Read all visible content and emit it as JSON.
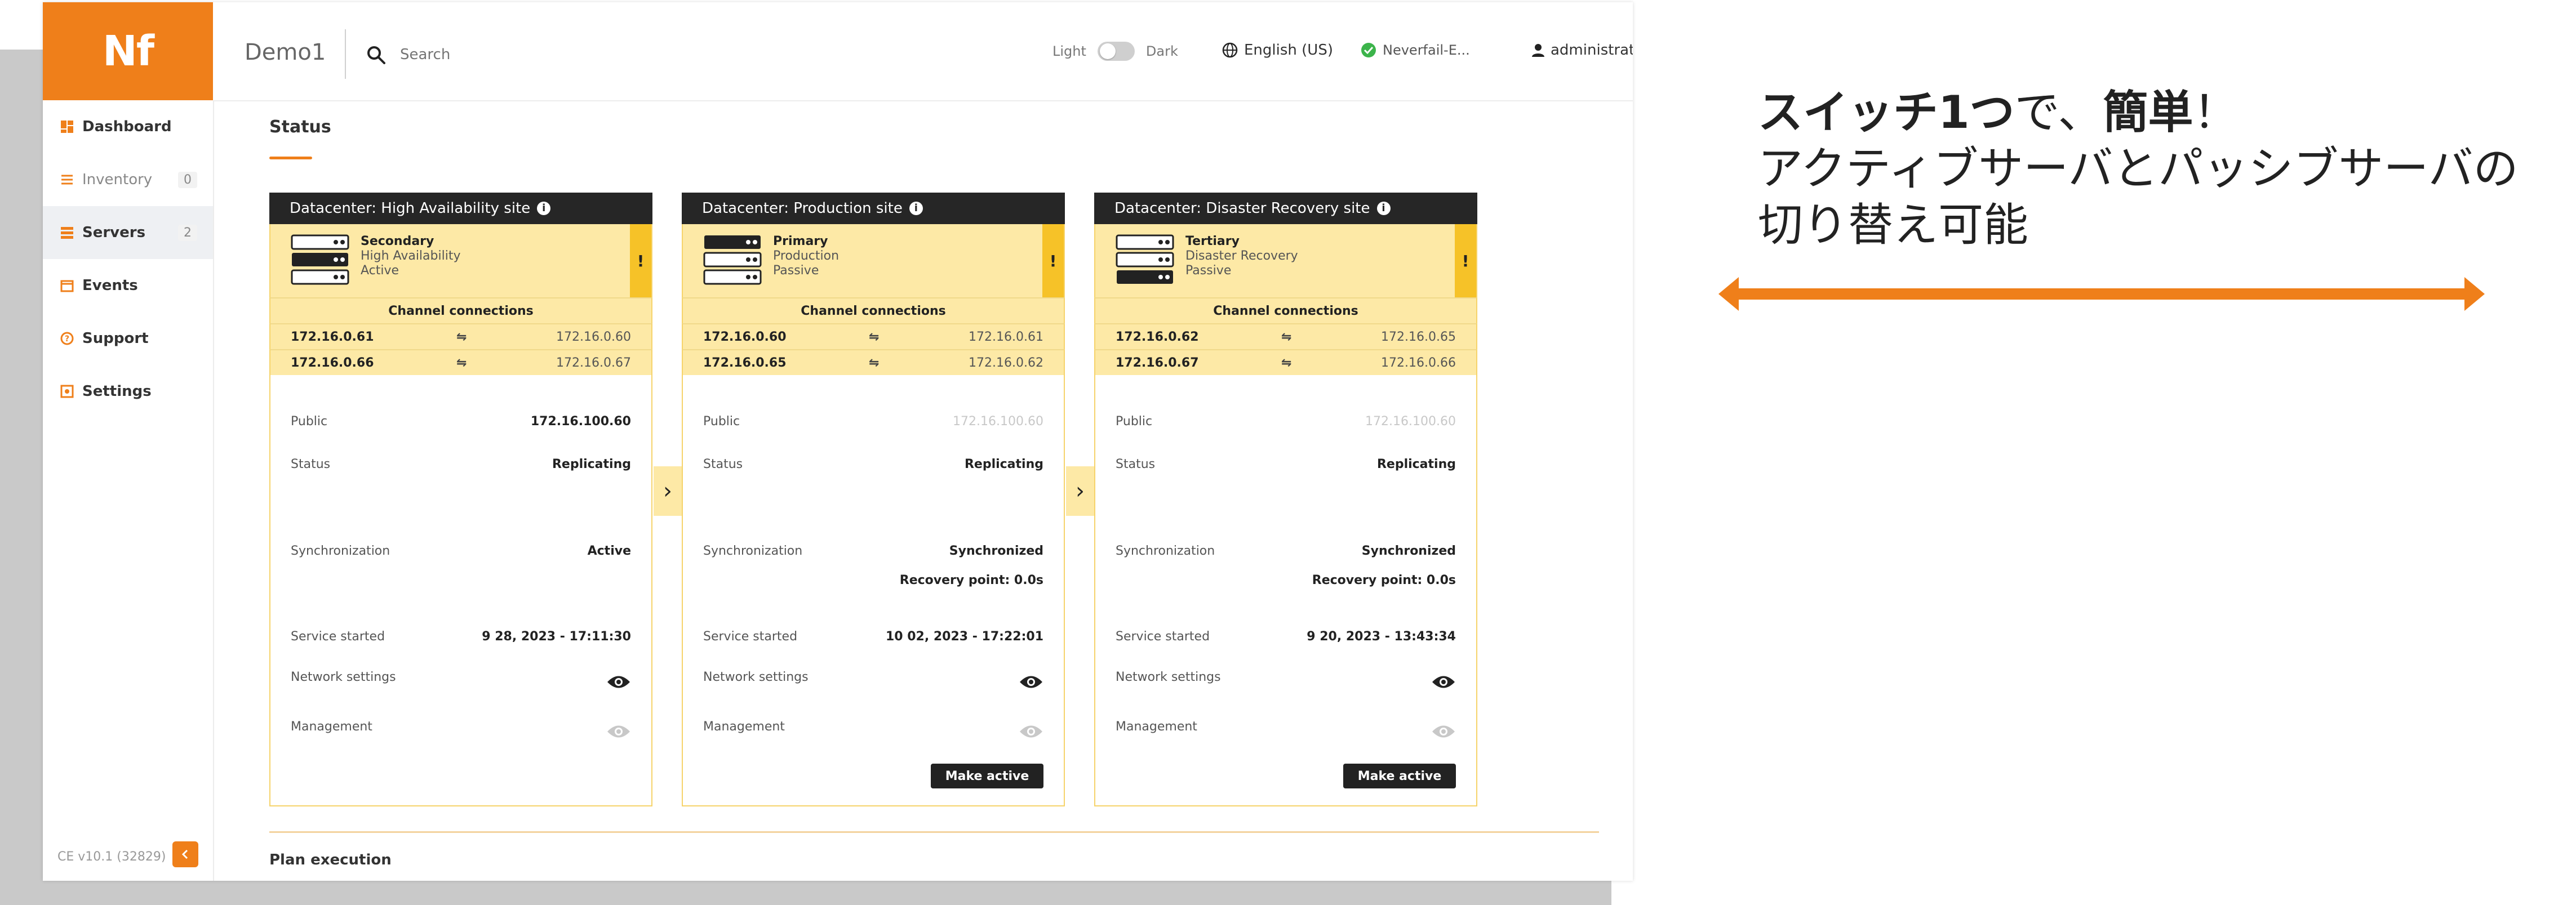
{
  "app": {
    "logo_text": "Nf",
    "server_name": "Demo1",
    "search_placeholder": "Search",
    "theme_light": "Light",
    "theme_dark": "Dark",
    "language": "English (US)",
    "status_label": "Neverfail-E...",
    "user": "administrator",
    "accent_color": "#ef7f1a"
  },
  "sidebar": {
    "items": [
      {
        "label": "Dashboard",
        "icon": "dashboard-icon"
      },
      {
        "label": "Inventory",
        "icon": "list-icon",
        "count": "0"
      },
      {
        "label": "Servers",
        "icon": "servers-icon",
        "count": "2"
      },
      {
        "label": "Events",
        "icon": "calendar-icon"
      },
      {
        "label": "Support",
        "icon": "help-icon"
      },
      {
        "label": "Settings",
        "icon": "gear-icon"
      }
    ],
    "version": "CE v10.1 (32829)"
  },
  "main": {
    "section_title": "Status",
    "plan_title": "Plan execution",
    "cards": [
      {
        "datacenter": "Datacenter: High Availability site",
        "role": "Secondary",
        "role_sub1": "High Availability",
        "role_sub2": "Active",
        "channel_title": "Channel connections",
        "connections": [
          {
            "left": "172.16.0.61",
            "right": "172.16.0.60"
          },
          {
            "left": "172.16.0.66",
            "right": "172.16.0.67"
          }
        ],
        "public_label": "Public",
        "public_value": "172.16.100.60",
        "public_muted": false,
        "status_label": "Status",
        "status_value": "Replicating",
        "sync_label": "Synchronization",
        "sync_value": "Active",
        "sync_extra": "",
        "service_label": "Service started",
        "service_value": "9 28, 2023 - 17:11:30",
        "network_label": "Network settings",
        "management_label": "Management",
        "action": ""
      },
      {
        "datacenter": "Datacenter: Production site",
        "role": "Primary",
        "role_sub1": "Production",
        "role_sub2": "Passive",
        "channel_title": "Channel connections",
        "connections": [
          {
            "left": "172.16.0.60",
            "right": "172.16.0.61"
          },
          {
            "left": "172.16.0.65",
            "right": "172.16.0.62"
          }
        ],
        "public_label": "Public",
        "public_value": "172.16.100.60",
        "public_muted": true,
        "status_label": "Status",
        "status_value": "Replicating",
        "sync_label": "Synchronization",
        "sync_value": "Synchronized",
        "sync_extra": "Recovery point: 0.0s",
        "service_label": "Service started",
        "service_value": "10 02, 2023 - 17:22:01",
        "network_label": "Network settings",
        "management_label": "Management",
        "action": "Make active"
      },
      {
        "datacenter": "Datacenter: Disaster Recovery site",
        "role": "Tertiary",
        "role_sub1": "Disaster Recovery",
        "role_sub2": "Passive",
        "channel_title": "Channel connections",
        "connections": [
          {
            "left": "172.16.0.62",
            "right": "172.16.0.65"
          },
          {
            "left": "172.16.0.67",
            "right": "172.16.0.66"
          }
        ],
        "public_label": "Public",
        "public_value": "172.16.100.60",
        "public_muted": true,
        "status_label": "Status",
        "status_value": "Replicating",
        "sync_label": "Synchronization",
        "sync_value": "Synchronized",
        "sync_extra": "Recovery point: 0.0s",
        "service_label": "Service started",
        "service_value": "9 20, 2023 - 13:43:34",
        "network_label": "Network settings",
        "management_label": "Management",
        "action": "Make active"
      }
    ]
  },
  "annotation": {
    "line1_bold1": "スイッチ1つ",
    "line1_normal": "で、",
    "line1_bold2": "簡単",
    "line1_end": "！",
    "line2": "アクティブサーバとパッシブサーバの",
    "line3": "切り替え可能",
    "arrow_color": "#ef7f1a"
  }
}
